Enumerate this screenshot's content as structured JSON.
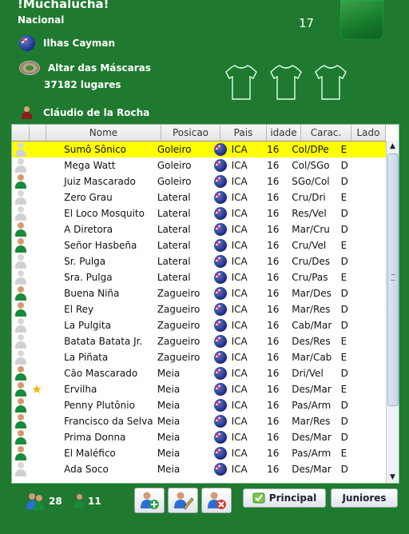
{
  "header": {
    "title": "!Muchalucha!",
    "subtitle": "Nacional",
    "counter": "17",
    "country": "Ilhas Cayman",
    "stadium_name": "Altar das Máscaras",
    "stadium_capacity": "37182 lugares",
    "coach": "Cláudio de la Rocha"
  },
  "table": {
    "columns": [
      "Nome",
      "Posicao",
      "Pais",
      "idade",
      "Carac.",
      "Lado"
    ],
    "rows": [
      {
        "name": "Sumô Sônico",
        "pos": "Goleiro",
        "pais": "ICA",
        "age": "16",
        "carac": "Col/DPe",
        "lado": "E",
        "selected": true,
        "avatar": "gray",
        "star": false
      },
      {
        "name": "Mega Watt",
        "pos": "Goleiro",
        "pais": "ICA",
        "age": "16",
        "carac": "Col/SGo",
        "lado": "D",
        "selected": false,
        "avatar": "gray",
        "star": false
      },
      {
        "name": "Juiz Mascarado",
        "pos": "Goleiro",
        "pais": "ICA",
        "age": "16",
        "carac": "SGo/Col",
        "lado": "D",
        "selected": false,
        "avatar": "green",
        "star": false
      },
      {
        "name": "Zero Grau",
        "pos": "Lateral",
        "pais": "ICA",
        "age": "16",
        "carac": "Cru/Dri",
        "lado": "E",
        "selected": false,
        "avatar": "gray",
        "star": false
      },
      {
        "name": "El Loco Mosquito",
        "pos": "Lateral",
        "pais": "ICA",
        "age": "16",
        "carac": "Res/Vel",
        "lado": "D",
        "selected": false,
        "avatar": "gray",
        "star": false
      },
      {
        "name": "A Diretora",
        "pos": "Lateral",
        "pais": "ICA",
        "age": "16",
        "carac": "Mar/Cru",
        "lado": "D",
        "selected": false,
        "avatar": "green",
        "star": false
      },
      {
        "name": "Señor Hasbeña",
        "pos": "Lateral",
        "pais": "ICA",
        "age": "16",
        "carac": "Cru/Vel",
        "lado": "E",
        "selected": false,
        "avatar": "green",
        "star": false
      },
      {
        "name": "Sr. Pulga",
        "pos": "Lateral",
        "pais": "ICA",
        "age": "16",
        "carac": "Cru/Des",
        "lado": "D",
        "selected": false,
        "avatar": "gray",
        "star": false
      },
      {
        "name": "Sra. Pulga",
        "pos": "Lateral",
        "pais": "ICA",
        "age": "16",
        "carac": "Cru/Pas",
        "lado": "E",
        "selected": false,
        "avatar": "gray",
        "star": false
      },
      {
        "name": "Buena Niña",
        "pos": "Zagueiro",
        "pais": "ICA",
        "age": "16",
        "carac": "Mar/Des",
        "lado": "D",
        "selected": false,
        "avatar": "green",
        "star": false
      },
      {
        "name": "El Rey",
        "pos": "Zagueiro",
        "pais": "ICA",
        "age": "16",
        "carac": "Mar/Res",
        "lado": "D",
        "selected": false,
        "avatar": "green",
        "star": false
      },
      {
        "name": "La Pulgita",
        "pos": "Zagueiro",
        "pais": "ICA",
        "age": "16",
        "carac": "Cab/Mar",
        "lado": "D",
        "selected": false,
        "avatar": "gray",
        "star": false
      },
      {
        "name": "Batata Batata Jr.",
        "pos": "Zagueiro",
        "pais": "ICA",
        "age": "16",
        "carac": "Des/Res",
        "lado": "E",
        "selected": false,
        "avatar": "gray",
        "star": false
      },
      {
        "name": "La Piñata",
        "pos": "Zagueiro",
        "pais": "ICA",
        "age": "16",
        "carac": "Mar/Cab",
        "lado": "E",
        "selected": false,
        "avatar": "gray",
        "star": false
      },
      {
        "name": "Cão Mascarado",
        "pos": "Meia",
        "pais": "ICA",
        "age": "16",
        "carac": "Dri/Vel",
        "lado": "D",
        "selected": false,
        "avatar": "green",
        "star": false
      },
      {
        "name": "Ervilha",
        "pos": "Meia",
        "pais": "ICA",
        "age": "16",
        "carac": "Des/Mar",
        "lado": "E",
        "selected": false,
        "avatar": "green",
        "star": true
      },
      {
        "name": "Penny Plutônio",
        "pos": "Meia",
        "pais": "ICA",
        "age": "16",
        "carac": "Pas/Arm",
        "lado": "D",
        "selected": false,
        "avatar": "green",
        "star": false
      },
      {
        "name": "Francisco da Selva",
        "pos": "Meia",
        "pais": "ICA",
        "age": "16",
        "carac": "Mar/Res",
        "lado": "D",
        "selected": false,
        "avatar": "green",
        "star": false
      },
      {
        "name": "Prima Donna",
        "pos": "Meia",
        "pais": "ICA",
        "age": "16",
        "carac": "Des/Mar",
        "lado": "D",
        "selected": false,
        "avatar": "green",
        "star": false
      },
      {
        "name": "El Maléfico",
        "pos": "Meia",
        "pais": "ICA",
        "age": "16",
        "carac": "Pas/Arm",
        "lado": "E",
        "selected": false,
        "avatar": "green",
        "star": false
      },
      {
        "name": "Ada Soco",
        "pos": "Meia",
        "pais": "ICA",
        "age": "16",
        "carac": "Des/Mar",
        "lado": "D",
        "selected": false,
        "avatar": "gray",
        "star": false
      }
    ]
  },
  "footer": {
    "total_players": "28",
    "selected_players": "11",
    "btn_principal": "Principal",
    "btn_juniores": "Juniores"
  },
  "icons": {
    "star": "★",
    "scroll_up": "▲",
    "scroll_down": "▼"
  },
  "colors": {
    "background": "#1f7a2f",
    "selected_row": "#ffff00"
  }
}
